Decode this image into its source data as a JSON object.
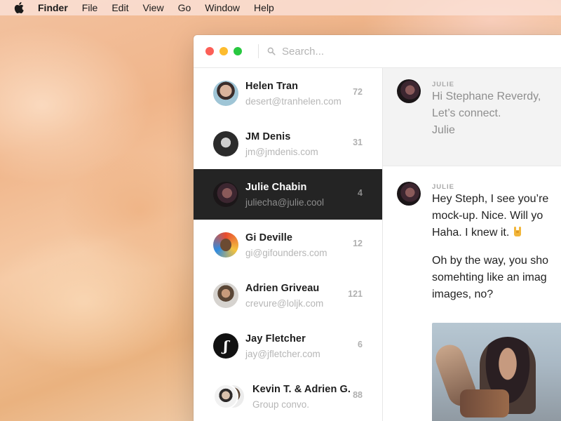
{
  "menubar": {
    "app_name": "Finder",
    "items": [
      "File",
      "Edit",
      "View",
      "Go",
      "Window",
      "Help"
    ]
  },
  "search": {
    "placeholder": "Search..."
  },
  "contacts": [
    {
      "name": "Helen Tran",
      "email": "desert@tranhelen.com",
      "count": "72"
    },
    {
      "name": "JM Denis",
      "email": "jm@jmdenis.com",
      "count": "31"
    },
    {
      "name": "Julie Chabin",
      "email": "juliecha@julie.cool",
      "count": "4",
      "selected": true
    },
    {
      "name": "Gi Deville",
      "email": "gi@gifounders.com",
      "count": "12"
    },
    {
      "name": "Adrien Griveau",
      "email": "crevure@loljk.com",
      "count": "121"
    },
    {
      "name": "Jay Fletcher",
      "email": "jay@jfletcher.com",
      "count": "6",
      "avatar_letter": "ʃ"
    },
    {
      "name": "Kevin T. & Adrien G.",
      "email": "Group convo.",
      "count": "88"
    }
  ],
  "messages": [
    {
      "sender": "JULIE",
      "lines": [
        "Hi Stephane Reverdy,",
        "Let’s connect.",
        "Julie"
      ]
    },
    {
      "sender": "JULIE",
      "lines": [
        "Hey Steph, I see you’re",
        "mock-up. Nice. Will yo",
        "Haha. I knew it."
      ],
      "lines2": [
        "Oh by the way, you sho",
        "somehting like an imag",
        "images, no?"
      ]
    }
  ],
  "colors": {
    "selected_row": "#242424",
    "close": "#fc5f57",
    "minimize": "#fdbc2e",
    "maximize": "#28c840"
  }
}
